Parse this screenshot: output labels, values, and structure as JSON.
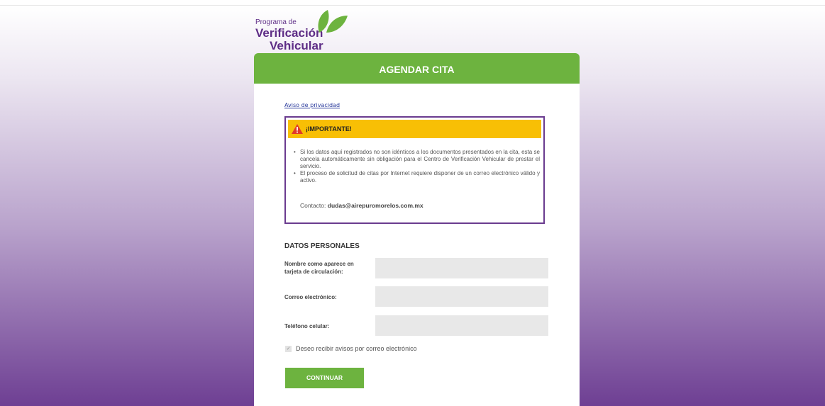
{
  "colors": {
    "brand_green": "#6db33f",
    "brand_purple": "#5e2d86",
    "warning_yellow": "#f8bf05"
  },
  "logo": {
    "line1": "Programa de",
    "line2": "Verificación",
    "line3": "Vehicular",
    "icon": "leaves-icon"
  },
  "header": {
    "title": "AGENDAR CITA"
  },
  "privacy_link": "Aviso de privacidad",
  "notice": {
    "icon": "warning-icon",
    "title": "¡IMPORTANTE!",
    "items": [
      "Si los datos aquí registrados no son idénticos a los documentos presentados en la cita, esta se cancela automáticamente sin obligación para el Centro de Verificación Vehicular de prestar el servicio.",
      "El proceso de solicitud de citas por Internet requiere disponer de un correo electrónico válido y activo."
    ],
    "contact_label": "Contacto:",
    "contact_email": "dudas@airepuromorelos.com.mx"
  },
  "form": {
    "section_title": "DATOS PERSONALES",
    "name_label_1": "Nombre como aparece en",
    "name_label_2": "tarjeta de circulación:",
    "name_value": "",
    "email_label": "Correo electrónico:",
    "email_value": "",
    "phone_label": "Teléfono celular:",
    "phone_value": "",
    "checkbox_label": "Deseo recibir avisos por correo electrónico",
    "checkbox_checked": true,
    "submit_label": "CONTINUAR"
  }
}
